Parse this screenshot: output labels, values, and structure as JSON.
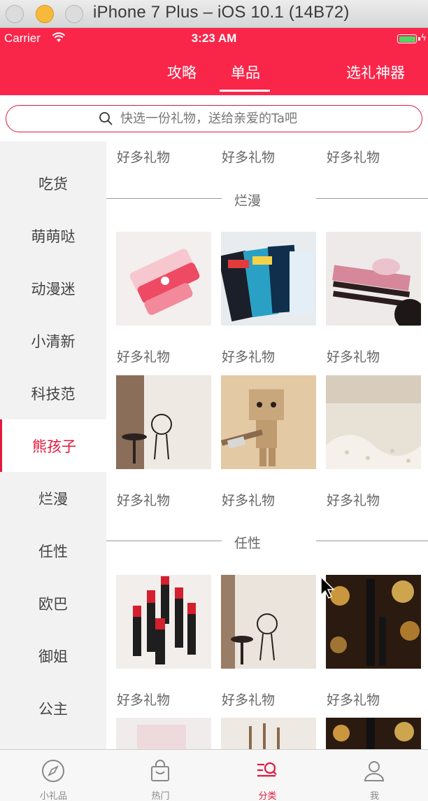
{
  "window": {
    "title": "iPhone 7 Plus – iOS 10.1 (14B72)"
  },
  "status_bar": {
    "carrier": "Carrier",
    "time": "3:23 AM"
  },
  "nav": {
    "tabs": [
      {
        "label": "攻略"
      },
      {
        "label": "单品",
        "active": true
      },
      {
        "label": "选礼神器"
      }
    ]
  },
  "search": {
    "placeholder": "快选一份礼物，送给亲爱的Ta吧"
  },
  "sidebar": {
    "items": [
      {
        "label": "吃货"
      },
      {
        "label": "萌萌哒"
      },
      {
        "label": "动漫迷"
      },
      {
        "label": "小清新"
      },
      {
        "label": "科技范"
      },
      {
        "label": "熊孩子",
        "active": true
      },
      {
        "label": "烂漫"
      },
      {
        "label": "任性"
      },
      {
        "label": "欧巴"
      },
      {
        "label": "御姐"
      },
      {
        "label": "公主"
      }
    ]
  },
  "content": {
    "gift_label": "好多礼物",
    "sections": [
      {
        "title": "烂漫"
      },
      {
        "title": "任性"
      }
    ],
    "images": [
      {
        "name": "lipstick-tubes-image",
        "caption": ""
      },
      {
        "name": "face-masks-image",
        "caption": ""
      },
      {
        "name": "eyeliner-pens-image",
        "caption": ""
      },
      {
        "name": "lace-curtain-chair-image",
        "caption": ""
      },
      {
        "name": "danbo-figure-image",
        "caption": ""
      },
      {
        "name": "lace-curtain-closeup-image",
        "caption": ""
      },
      {
        "name": "red-lipsticks-image",
        "caption": ""
      },
      {
        "name": "curtain-chair-image",
        "caption": ""
      },
      {
        "name": "mascara-bokeh-image",
        "caption": ""
      }
    ]
  },
  "tabbar": {
    "items": [
      {
        "label": "小礼品",
        "icon": "compass-icon"
      },
      {
        "label": "热门",
        "icon": "shopping-bag-icon"
      },
      {
        "label": "分类",
        "icon": "category-search-icon",
        "active": true
      },
      {
        "label": "我",
        "icon": "person-icon"
      }
    ]
  },
  "colors": {
    "brand": "#f9264a",
    "accent": "#e3183c"
  }
}
